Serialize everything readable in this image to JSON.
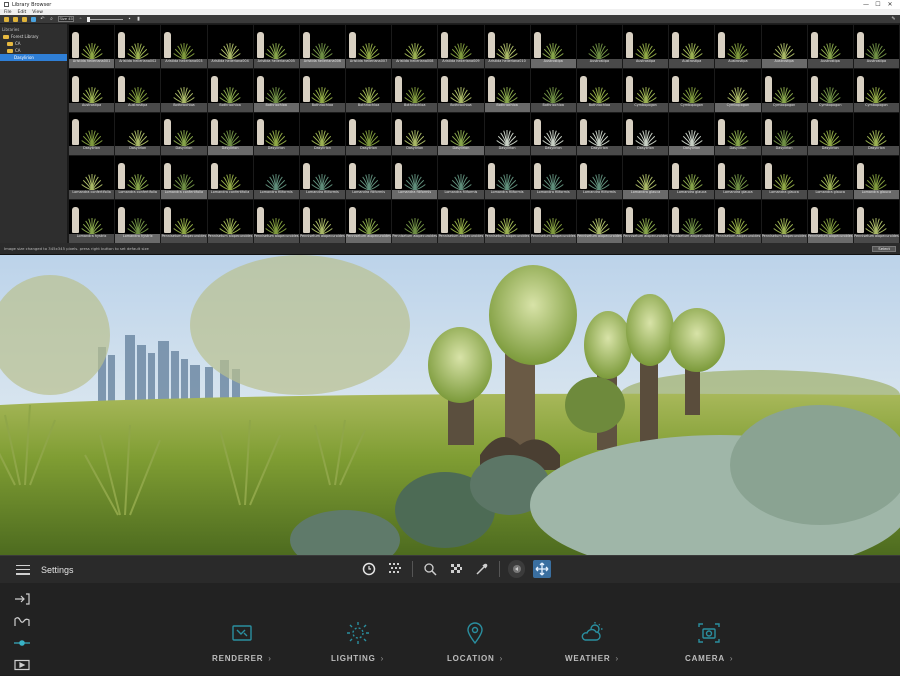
{
  "window": {
    "title": "Library Browser",
    "menu": [
      "File",
      "Edit",
      "View"
    ],
    "size_field": "Size 45",
    "close": "✕",
    "minimize": "—",
    "maximize": "☐"
  },
  "tree": {
    "header": "Libraries",
    "items": [
      {
        "label": "Forest Library",
        "selected": false
      },
      {
        "label": "CA",
        "selected": false
      },
      {
        "label": "CA",
        "selected": false
      },
      {
        "label": "Dasylirion",
        "selected": true
      }
    ]
  },
  "thumbnails": {
    "rows": [
      {
        "prefix": "Aristida",
        "labels": [
          "Aristida helleriana001",
          "Aristida helleriana002",
          "Aristida helleriana003",
          "Aristida helleriana004",
          "Aristida helleriana005",
          "Aristida helleriana006",
          "Aristida helleriana007",
          "Aristida helleriana008",
          "Aristida helleriana009",
          "Aristida helleriana010",
          "Austrostipa",
          "Austrostipa",
          "Austrostipa",
          "Austrostipa",
          "Austrostipa",
          "Austrostipa",
          "Austrostipa",
          "Austrostipa"
        ]
      },
      {
        "prefix": "Austrostipa",
        "labels": [
          "Austrostipa",
          "Austrostipa",
          "Bothriochloa",
          "Bothriochloa",
          "Bothriochloa",
          "Bothriochloa",
          "Bothriochloa",
          "Bothriochloa",
          "Bothriochloa",
          "Bothriochloa",
          "Bothriochloa",
          "Bothriochloa",
          "Cymbopogon",
          "Cymbopogon",
          "Cymbopogon",
          "Cymbopogon",
          "Cymbopogon",
          "Cymbopogon"
        ]
      },
      {
        "prefix": "Dasylirion",
        "labels": [
          "Dasylirion",
          "Dasylirion",
          "Dasylirion",
          "Dasylirion",
          "Dasylirion",
          "Dasylirion",
          "Dasylirion",
          "Dasylirion",
          "Dasylirion",
          "Dasylirion",
          "Dasylirion",
          "Dasylirion",
          "Dasylirion",
          "Dasylirion",
          "Dasylirion",
          "Dasylirion",
          "Dasylirion",
          "Dasylirion"
        ]
      },
      {
        "prefix": "Lomandra",
        "labels": [
          "Lomandra confertifolia",
          "Lomandra confertifolia",
          "Lomandra confertifolia",
          "Lomandra confertifolia",
          "Lomandra filiformis",
          "Lomandra filiformis",
          "Lomandra filiformis",
          "Lomandra filiformis",
          "Lomandra filiformis",
          "Lomandra filiformis",
          "Lomandra filiformis",
          "Lomandra filiformis",
          "Lomandra glauca",
          "Lomandra glauca",
          "Lomandra glauca",
          "Lomandra glauca",
          "Lomandra glauca",
          "Lomandra glauca"
        ]
      },
      {
        "prefix": "Lomandra",
        "labels": [
          "Lomandra hystrix",
          "Lomandra hystrix",
          "Pennisetum alopecuroides",
          "Pennisetum alopecuroides",
          "Pennisetum alopecuroides",
          "Pennisetum alopecuroides",
          "Pennisetum alopecuroides",
          "Pennisetum alopecuroides",
          "Pennisetum alopecuroides",
          "Pennisetum alopecuroides",
          "Pennisetum alopecuroides",
          "Pennisetum alopecuroides",
          "Pennisetum alopecuroides",
          "Pennisetum alopecuroides",
          "Pennisetum alopecuroides",
          "Pennisetum alopecuroides",
          "Pennisetum alopecuroides",
          "Pennisetum alopecuroides"
        ]
      }
    ]
  },
  "status": {
    "text": "Image size changed to 345x345 pixels. press right button to set default size",
    "select_button": "Select"
  },
  "settings": {
    "title": "Settings",
    "categories": [
      {
        "label": "RENDERER",
        "icon": "renderer-icon"
      },
      {
        "label": "LIGHTING",
        "icon": "lighting-icon"
      },
      {
        "label": "LOCATION",
        "icon": "location-icon"
      },
      {
        "label": "WEATHER",
        "icon": "weather-icon"
      },
      {
        "label": "CAMERA",
        "icon": "camera-icon"
      }
    ],
    "chevron": "›",
    "accent_color": "#2a8fa0",
    "active_rail_color": "#39b3c7"
  }
}
